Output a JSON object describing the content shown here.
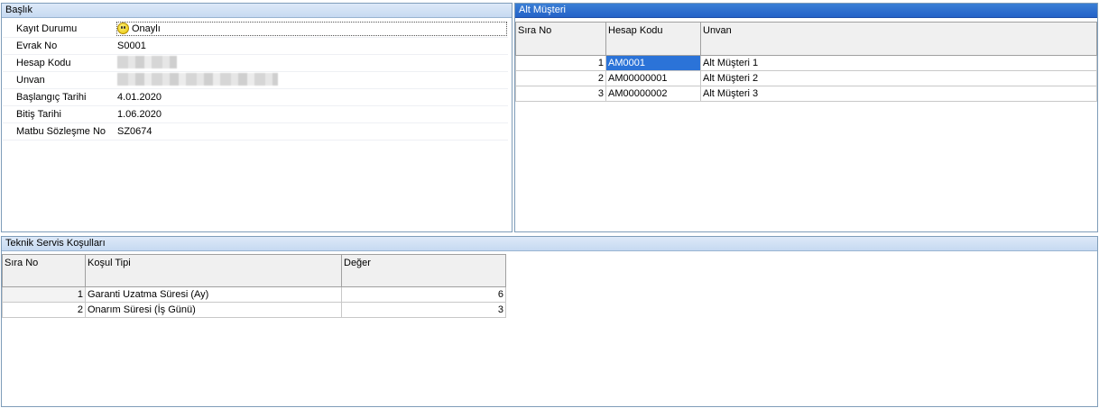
{
  "baslik": {
    "title": "Başlık",
    "fields": [
      {
        "label": "Kayıt Durumu",
        "value": "Onaylı"
      },
      {
        "label": "Evrak No",
        "value": "S0001"
      },
      {
        "label": "Hesap Kodu",
        "value": ""
      },
      {
        "label": "Unvan",
        "value": ""
      },
      {
        "label": "Başlangıç Tarihi",
        "value": "4.01.2020"
      },
      {
        "label": "Bitiş Tarihi",
        "value": "1.06.2020"
      },
      {
        "label": "Matbu Sözleşme No",
        "value": "SZ0674"
      }
    ]
  },
  "alt_musteri": {
    "title": "Alt Müşteri",
    "columns": [
      "Sıra No",
      "Hesap Kodu",
      "Unvan"
    ],
    "rows": [
      [
        "1",
        "AM0001",
        "Alt Müşteri 1"
      ],
      [
        "2",
        "AM00000001",
        "Alt Müşteri 2"
      ],
      [
        "3",
        "AM00000002",
        "Alt Müşteri 3"
      ]
    ]
  },
  "teknik": {
    "title": "Teknik Servis Koşulları",
    "columns": [
      "Sıra No",
      "Koşul Tipi",
      "Değer"
    ],
    "rows": [
      [
        "1",
        "Garanti Uzatma Süresi (Ay)",
        "6"
      ],
      [
        "2",
        "Onarım Süresi (İş Günü)",
        "3"
      ]
    ]
  },
  "colors": {
    "header_blue": "#2462c8",
    "selection": "#2b73d8"
  }
}
